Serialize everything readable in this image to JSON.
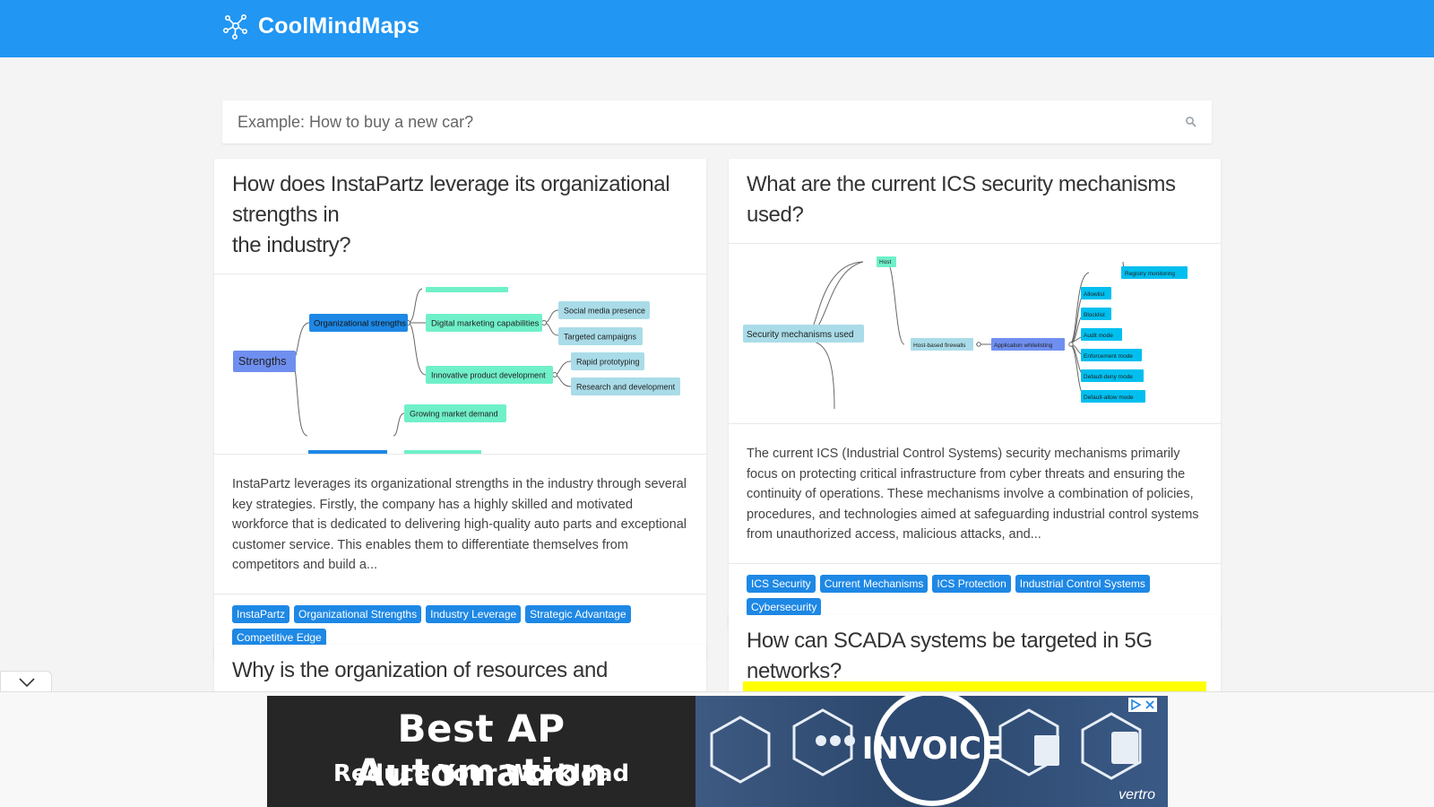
{
  "app": {
    "brand": "CoolMindMaps"
  },
  "search": {
    "placeholder": "Example: How to buy a new car?"
  },
  "cards": [
    {
      "title_lines": [
        "How does InstaPartz leverage its organizational strengths in",
        "the industry?"
      ],
      "map_nodes": {
        "root": "Strengths",
        "org": "Organizational strengths",
        "digital": "Digital marketing capabilities",
        "social": "Social media presence",
        "targeted": "Targeted campaigns",
        "innovative": "Innovative product development",
        "rapid": "Rapid prototyping",
        "research": "Research and development",
        "growing": "Growing market demand"
      },
      "description": "InstaPartz leverages its organizational strengths in the industry through several key strategies. Firstly, the company has a highly skilled and motivated workforce that is dedicated to delivering high-quality auto parts and exceptional customer service. This enables them to differentiate themselves from competitors and build a...",
      "tags": [
        "InstaPartz",
        "Organizational Strengths",
        "Industry Leverage",
        "Strategic Advantage",
        "Competitive Edge"
      ]
    },
    {
      "title_lines": [
        "What are the current ICS security mechanisms used?"
      ],
      "map_nodes": {
        "root": "Security mechanisms used",
        "host": "Host",
        "hostfw": "Host-based firewalls",
        "appwl": "Application whitelisting",
        "registry": "Registry monitoring",
        "allowlist": "Allowlist",
        "blocklist": "Blocklist",
        "audit": "Audit mode",
        "enforcement": "Enforcement mode",
        "defdeny": "Default-deny mode",
        "defallow": "Default-allow mode"
      },
      "description": "The current ICS (Industrial Control Systems) security mechanisms primarily focus on protecting critical infrastructure from cyber threats and ensuring the continuity of operations. These mechanisms involve a combination of policies, procedures, and technologies aimed at safeguarding industrial control systems from unauthorized access, malicious attacks, and...",
      "tags": [
        "ICS Security",
        "Current Mechanisms",
        "ICS Protection",
        "Industrial Control Systems",
        "Cybersecurity"
      ]
    },
    {
      "title_lines": [
        "Why is the organization of resources and capabilities crucial"
      ]
    },
    {
      "title_lines": [
        "How can SCADA systems be targeted in 5G networks?"
      ]
    }
  ],
  "ad": {
    "headline": "Best AP Automation",
    "subline": "Reduce Your Workload",
    "center_label": "INVOICE",
    "brand": "vertro"
  },
  "colors": {
    "topbar": "#2196f3",
    "tag": "#1e88e5",
    "node_blue": "#1e88e5",
    "node_green": "#6ff0c8",
    "node_lightblue": "#a9dce8",
    "node_cyan": "#00bfef",
    "node_purple": "#6f8ff0",
    "ad_highlight": "#ffff00"
  }
}
